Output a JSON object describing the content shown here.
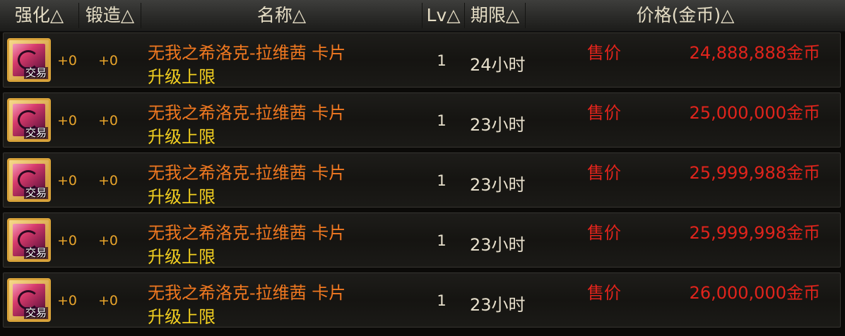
{
  "header": {
    "enhance": "强化△",
    "forge": "锻造△",
    "name": "名称△",
    "lv": "Lv△",
    "duration": "期限△",
    "price": "价格(金币)△"
  },
  "rows": [
    {
      "icon_tag": "交易",
      "enhance": "+0",
      "forge": "+0",
      "name": "无我之希洛克-拉维茜 卡片",
      "sub": "升级上限",
      "lv": "1",
      "duration": "24小时",
      "sell_label": "售价",
      "price": "24,888,888金币"
    },
    {
      "icon_tag": "交易",
      "enhance": "+0",
      "forge": "+0",
      "name": "无我之希洛克-拉维茜 卡片",
      "sub": "升级上限",
      "lv": "1",
      "duration": "23小时",
      "sell_label": "售价",
      "price": "25,000,000金币"
    },
    {
      "icon_tag": "交易",
      "enhance": "+0",
      "forge": "+0",
      "name": "无我之希洛克-拉维茜 卡片",
      "sub": "升级上限",
      "lv": "1",
      "duration": "23小时",
      "sell_label": "售价",
      "price": "25,999,988金币"
    },
    {
      "icon_tag": "交易",
      "enhance": "+0",
      "forge": "+0",
      "name": "无我之希洛克-拉维茜 卡片",
      "sub": "升级上限",
      "lv": "1",
      "duration": "23小时",
      "sell_label": "售价",
      "price": "25,999,998金币"
    },
    {
      "icon_tag": "交易",
      "enhance": "+0",
      "forge": "+0",
      "name": "无我之希洛克-拉维茜 卡片",
      "sub": "升级上限",
      "lv": "1",
      "duration": "23小时",
      "sell_label": "售价",
      "price": "26,000,000金币"
    }
  ],
  "icons": {
    "card": "card-icon"
  },
  "colors": {
    "item_name": "#f07820",
    "upgrade_note": "#f2d020",
    "price": "#e0241c",
    "enhance_value": "#e9a52b"
  }
}
